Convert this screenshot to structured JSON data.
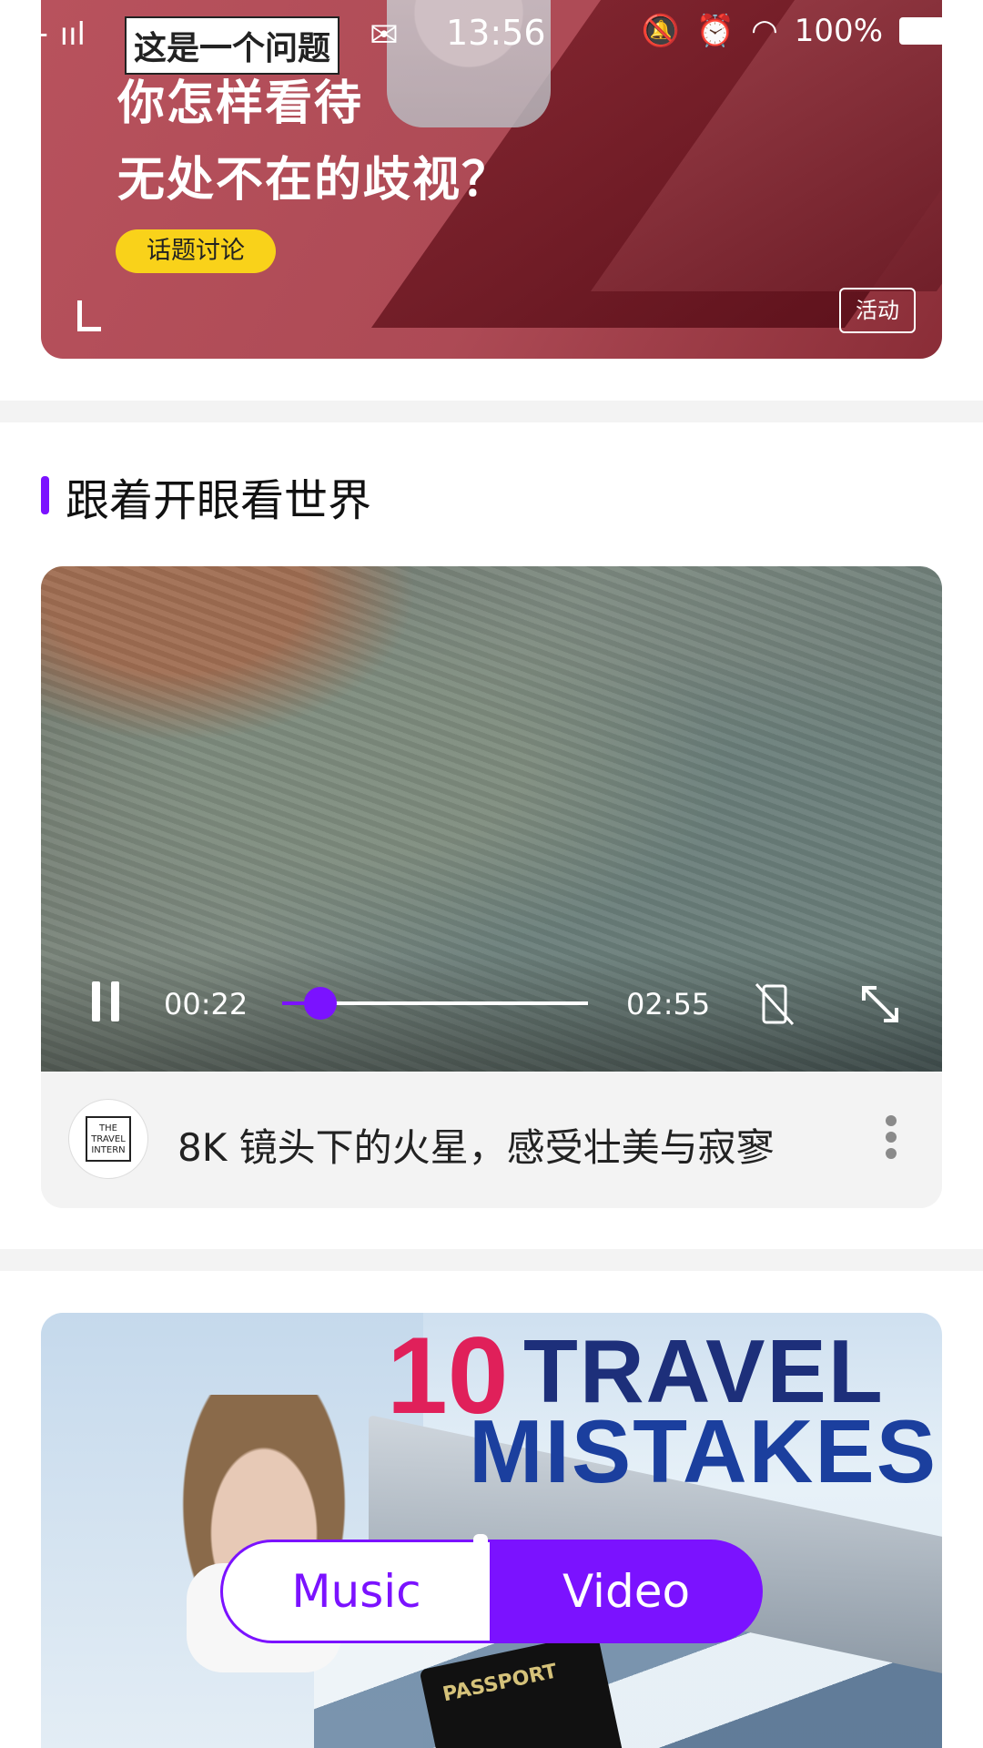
{
  "status_bar": {
    "signal": "G+ ııl",
    "time": "13:56",
    "battery": "100%",
    "icons": [
      "wechat-icon",
      "mute-icon",
      "alarm-icon",
      "wifi-icon",
      "battery-icon"
    ]
  },
  "banner": {
    "small_title": "这是一个问题",
    "title_line1": "你怎样看待",
    "title_line2": "无处不在的歧视？",
    "tag": "话题讨论",
    "badge": "活动"
  },
  "section": {
    "title": "跟着开眼看世界",
    "accent_color": "#7b12ff"
  },
  "video": {
    "current_time": "00:22",
    "total_time": "02:55",
    "progress": 0.126,
    "title": "8K 镜头下的火星，感受壮美与寂寥",
    "channel_logo_text": "THE TRAVEL INTERN"
  },
  "travel_card": {
    "number": "10",
    "line1": "TRAVEL",
    "line2": "MISTAKES",
    "passport_text": "PASSPORT"
  },
  "toggle": {
    "left_label": "Music",
    "right_label": "Video",
    "selected": "Video"
  }
}
